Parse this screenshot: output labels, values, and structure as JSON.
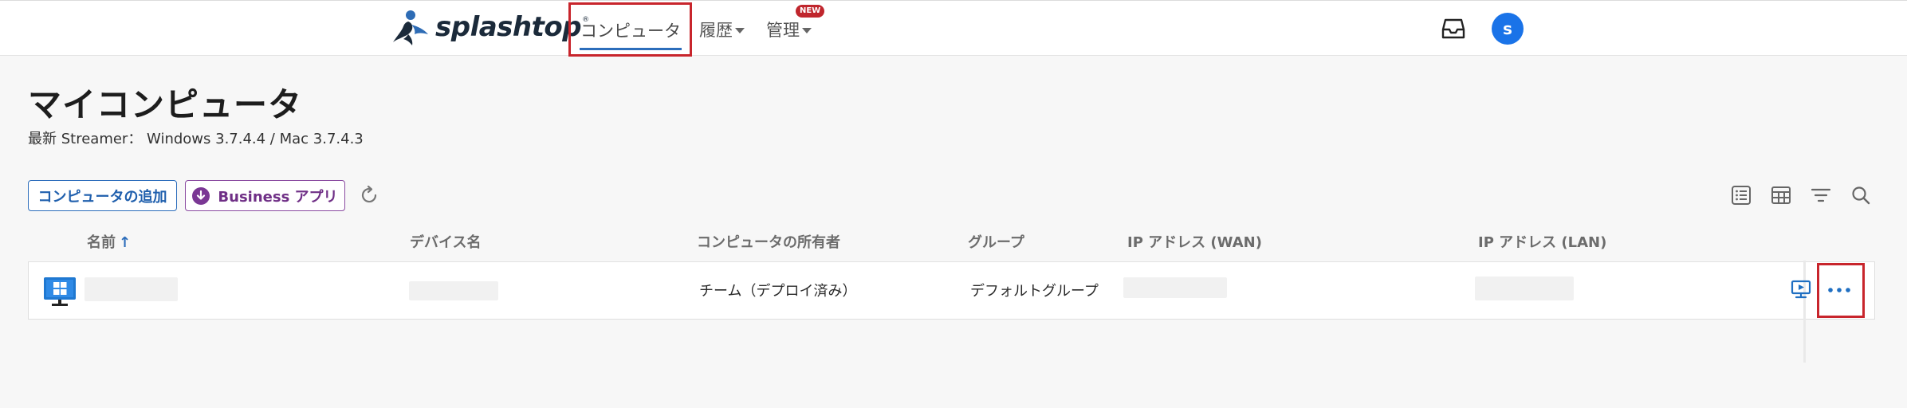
{
  "brand": {
    "name": "splashtop",
    "registered": "®",
    "color": "#1b2a3a",
    "mark_colors": [
      "#2e6cb5",
      "#1b2a3a"
    ]
  },
  "nav": {
    "computers": "コンピュータ",
    "history": "履歴",
    "admin": "管理",
    "admin_badge": "NEW",
    "avatar_initial": "s",
    "inbox_icon": "inbox-icon"
  },
  "page": {
    "title": "マイコンピュータ",
    "streamer": "最新 Streamer： Windows 3.7.4.4 / Mac 3.7.4.3"
  },
  "toolbar": {
    "add_computer": "コンピュータの追加",
    "business_app": "Business アプリ",
    "icons": [
      "refresh-icon",
      "list-view-icon",
      "grid-view-icon",
      "filter-icon",
      "search-icon"
    ]
  },
  "table": {
    "columns": [
      "名前",
      "デバイス名",
      "コンピュータの所有者",
      "グループ",
      "IP アドレス (WAN)",
      "IP アドレス (LAN)"
    ],
    "sort_indicator": "↑",
    "rows": [
      {
        "os_icon": "windows-monitor-icon",
        "name": "",
        "device": "",
        "owner": "チーム（デプロイ済み）",
        "group": "デフォルトグループ",
        "ip_wan": "",
        "ip_lan": "",
        "actions": [
          "remote-connect-icon",
          "more-options-icon"
        ]
      }
    ]
  },
  "colors": {
    "accent_blue": "#2c6dbb",
    "business_purple": "#7a3794",
    "highlight_red": "#c8252c",
    "badge_red": "#c0262d",
    "avatar_blue": "#1a73e8"
  }
}
